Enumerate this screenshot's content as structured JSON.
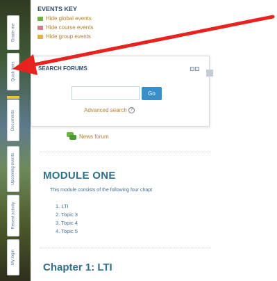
{
  "dock": {
    "tabs": [
      {
        "label": "Grade me"
      },
      {
        "label": "Quick links"
      },
      {
        "label": "Documents"
      },
      {
        "label": "Upcoming events"
      },
      {
        "label": "Recent activity"
      },
      {
        "label": "My login"
      }
    ]
  },
  "events_key": {
    "title": "EVENTS KEY",
    "items": [
      {
        "label": "Hide global events",
        "icon": "global-events-icon",
        "color": "#6fb23f"
      },
      {
        "label": "Hide course events",
        "icon": "course-events-icon",
        "color": "#d57a8a"
      },
      {
        "label": "Hide group events",
        "icon": "group-events-icon",
        "color": "#e3b04b"
      }
    ]
  },
  "search_forums": {
    "title": "SEARCH FORUMS",
    "input_value": "",
    "go_label": "Go",
    "advanced_label": "Advanced search",
    "help_glyph": "?"
  },
  "news_forum": {
    "label": "News forum"
  },
  "module": {
    "heading": "MODULE ONE",
    "description": "This module consists of the following four chapt",
    "topics": [
      "1. LTI",
      "2. Topic 3",
      "3. Topic 4",
      "4. Topic 5"
    ]
  },
  "chapter": {
    "heading": "Chapter 1: LTI"
  },
  "colors": {
    "annotation_arrow": "#e8231f",
    "link": "#b5802e",
    "heading": "#2f6f8a",
    "button": "#3b8fc8"
  }
}
